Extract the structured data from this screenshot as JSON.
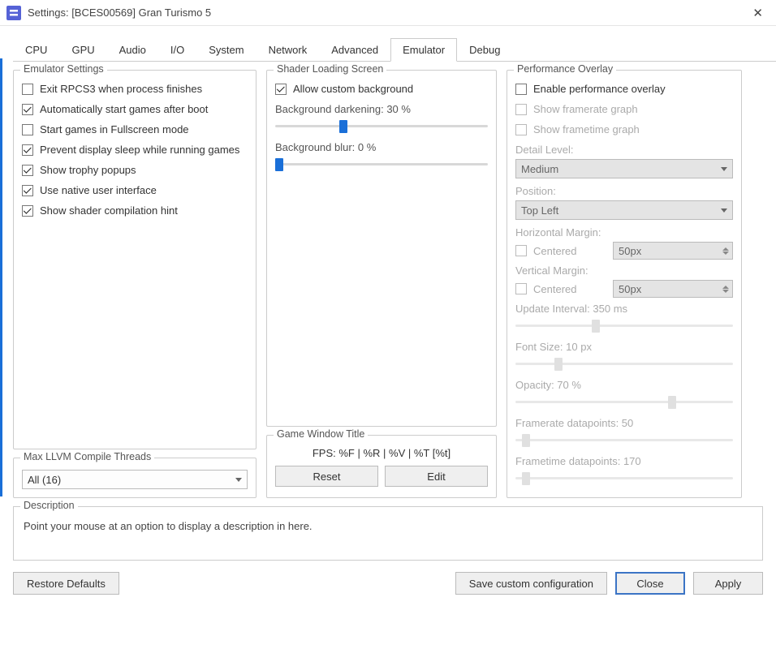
{
  "window": {
    "title": "Settings: [BCES00569] Gran Turismo 5"
  },
  "tabs": [
    "CPU",
    "GPU",
    "Audio",
    "I/O",
    "System",
    "Network",
    "Advanced",
    "Emulator",
    "Debug"
  ],
  "active_tab": "Emulator",
  "emulator_settings": {
    "title": "Emulator Settings",
    "items": [
      {
        "label": "Exit RPCS3 when process finishes",
        "checked": false
      },
      {
        "label": "Automatically start games after boot",
        "checked": true
      },
      {
        "label": "Start games in Fullscreen mode",
        "checked": false
      },
      {
        "label": "Prevent display sleep while running games",
        "checked": true
      },
      {
        "label": "Show trophy popups",
        "checked": true
      },
      {
        "label": "Use native user interface",
        "checked": true
      },
      {
        "label": "Show shader compilation hint",
        "checked": true
      }
    ]
  },
  "llvm": {
    "title": "Max LLVM Compile Threads",
    "value": "All (16)"
  },
  "shader": {
    "title": "Shader Loading Screen",
    "allow_bg": {
      "label": "Allow custom background",
      "checked": true
    },
    "darkening": {
      "label": "Background darkening: 30 %",
      "pct": 30
    },
    "blur": {
      "label": "Background blur: 0 %",
      "pct": 0
    }
  },
  "gamewindow": {
    "title": "Game Window Title",
    "format": "FPS: %F | %R | %V | %T [%t]",
    "reset": "Reset",
    "edit": "Edit"
  },
  "perf": {
    "title": "Performance Overlay",
    "enable": {
      "label": "Enable performance overlay",
      "checked": false
    },
    "fr_graph": {
      "label": "Show framerate graph",
      "checked": false,
      "disabled": true
    },
    "ft_graph": {
      "label": "Show frametime graph",
      "checked": false,
      "disabled": true
    },
    "detail_label": "Detail Level:",
    "detail_value": "Medium",
    "position_label": "Position:",
    "position_value": "Top Left",
    "hmargin_label": "Horizontal Margin:",
    "hmargin_centered": "Centered",
    "hmargin_value": "50px",
    "vmargin_label": "Vertical Margin:",
    "vmargin_centered": "Centered",
    "vmargin_value": "50px",
    "update": {
      "label": "Update Interval: 350 ms",
      "pct": 35
    },
    "font": {
      "label": "Font Size: 10 px",
      "pct": 20
    },
    "opacity": {
      "label": "Opacity: 70 %",
      "pct": 70
    },
    "fr_points": {
      "label": "Framerate datapoints: 50",
      "pct": 4
    },
    "ft_points": {
      "label": "Frametime datapoints: 170",
      "pct": 4
    }
  },
  "description": {
    "title": "Description",
    "text": "Point your mouse at an option to display a description in here."
  },
  "buttons": {
    "restore": "Restore Defaults",
    "save": "Save custom configuration",
    "close": "Close",
    "apply": "Apply"
  }
}
